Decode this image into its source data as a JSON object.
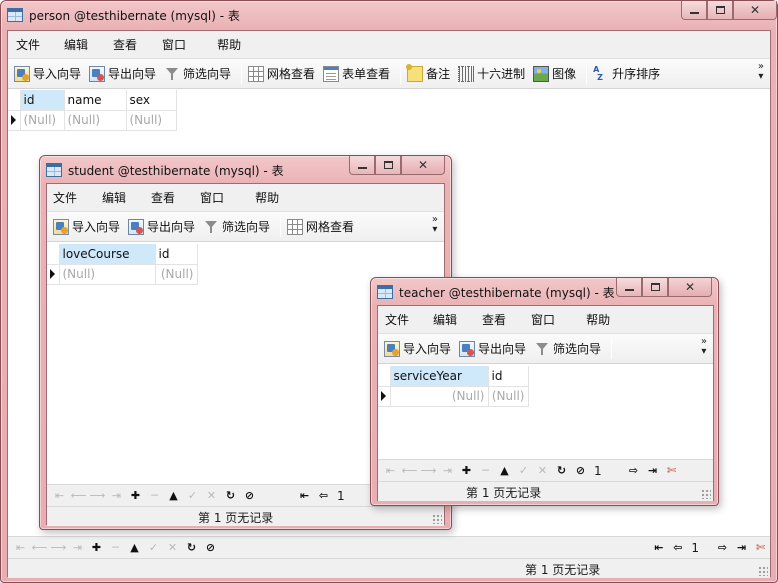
{
  "windows": {
    "person": {
      "title": "person @testhibernate (mysql) - 表",
      "menu": [
        "文件",
        "编辑",
        "查看",
        "窗口",
        "帮助"
      ],
      "toolbar": {
        "import": "导入向导",
        "export": "导出向导",
        "filter": "筛选向导",
        "grid_view": "网格查看",
        "form_view": "表单查看",
        "memo": "备注",
        "hex": "十六进制",
        "image": "图像",
        "sort_asc": "升序排序"
      },
      "columns": [
        "id",
        "name",
        "sex"
      ],
      "rows": [
        [
          "(Null)",
          "(Null)",
          "(Null)"
        ]
      ],
      "page_number": "1",
      "status": "第 1 页无记录"
    },
    "student": {
      "title": "student @testhibernate (mysql) - 表",
      "menu": [
        "文件",
        "编辑",
        "查看",
        "窗口",
        "帮助"
      ],
      "toolbar": {
        "import": "导入向导",
        "export": "导出向导",
        "filter": "筛选向导",
        "grid_view": "网格查看"
      },
      "columns": [
        "loveCourse",
        "id"
      ],
      "rows": [
        [
          "(Null)",
          "(Null)"
        ]
      ],
      "page_number": "1",
      "status": "第 1 页无记录"
    },
    "teacher": {
      "title": "teacher @testhibernate (mysql) - 表",
      "menu": [
        "文件",
        "编辑",
        "查看",
        "窗口",
        "帮助"
      ],
      "toolbar": {
        "import": "导入向导",
        "export": "导出向导",
        "filter": "筛选向导"
      },
      "columns": [
        "serviceYear",
        "id"
      ],
      "rows": [
        [
          "(Null)",
          "(Null)"
        ]
      ],
      "page_number": "1",
      "status": "第 1 页无记录"
    }
  },
  "nav_glyphs": {
    "first": "⇤",
    "prev": "⟵",
    "next": "⟶",
    "last": "⇥",
    "add": "✚",
    "delete": "─",
    "up": "▲",
    "apply": "✓",
    "cancel": "✕",
    "refresh": "↻",
    "stop": "⊘",
    "page_first": "⇤",
    "page_prev": "⇦",
    "page_next": "⇨",
    "page_last": "⇥",
    "settings": "✄"
  },
  "colors": {
    "window_frame": "#e8aeb2",
    "selected_header": "#cfe9fb",
    "null_text": "#a8a8a8"
  }
}
